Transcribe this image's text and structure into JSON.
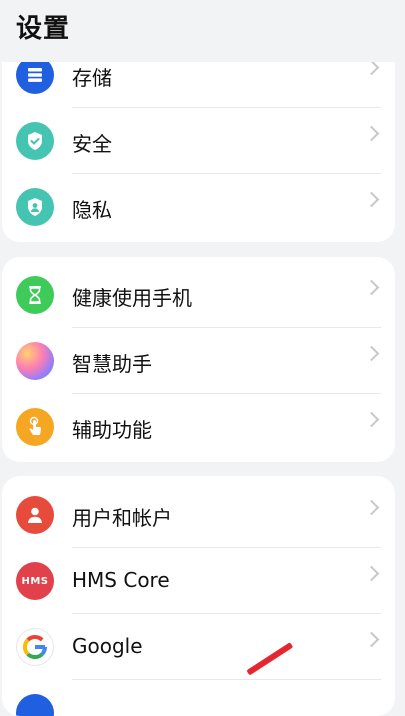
{
  "header": {
    "title": "设置"
  },
  "groups": {
    "g1": [
      {
        "label": "存储"
      },
      {
        "label": "安全"
      },
      {
        "label": "隐私"
      }
    ],
    "g2": [
      {
        "label": "健康使用手机"
      },
      {
        "label": "智慧助手"
      },
      {
        "label": "辅助功能"
      }
    ],
    "g3": [
      {
        "label": "用户和帐户"
      },
      {
        "label": "HMS Core",
        "icon_text": "HMS"
      },
      {
        "label": "Google",
        "icon_text": "G"
      }
    ]
  },
  "icons": {
    "storage": "storage-icon",
    "security": "shield-check-icon",
    "privacy": "privacy-shield-icon",
    "health": "hourglass-icon",
    "assistant": "assistant-orb-icon",
    "accessibility": "hand-tap-icon",
    "users": "user-icon",
    "hms": "hms-icon",
    "google": "google-icon"
  },
  "colors": {
    "storage": "#1f5fe0",
    "security": "#46c4b2",
    "privacy": "#46c4b2",
    "health": "#3ecb5a",
    "accessibility": "#f5a623",
    "users": "#e64b3b",
    "hms": "#e0414a"
  }
}
